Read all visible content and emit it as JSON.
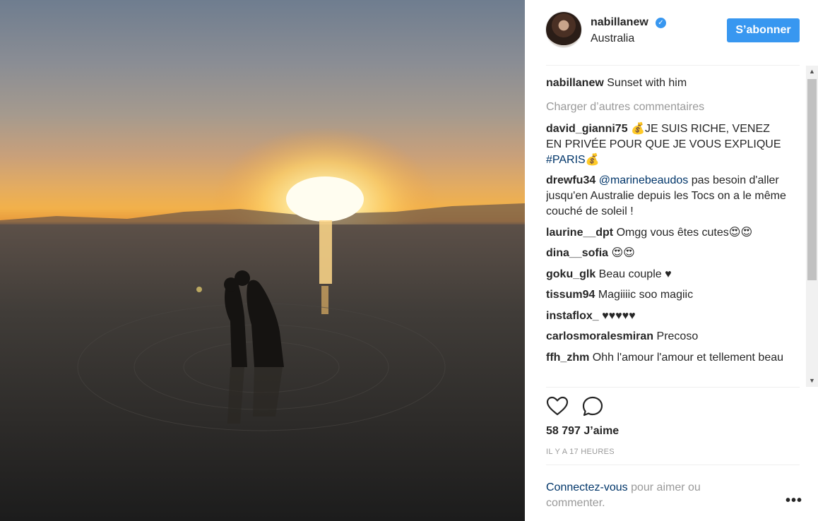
{
  "post": {
    "username": "nabillanew",
    "location": "Australia",
    "follow_label": "S’abonner",
    "verified_icon": "✓"
  },
  "comments": {
    "caption": {
      "user": "nabillanew",
      "text": "Sunset with him"
    },
    "load_more": "Charger d’autres commentaires",
    "items": [
      {
        "user": "david_gianni75",
        "text": " 💰JE SUIS RICHE, VENEZ EN PRIVÉE POUR QUE JE VOUS EXPLIQUE ",
        "tag": "#PARIS💰"
      },
      {
        "user": "drewfu34",
        "mention": "@marinebeaudos",
        "text": " pas besoin d'aller jusqu'en Australie depuis les Tocs on a le même couché de soleil !"
      },
      {
        "user": "laurine__dpt",
        "text": " Omgg vous êtes cutes😍😍"
      },
      {
        "user": "dina__sofia",
        "text": " 😍😍"
      },
      {
        "user": "goku_glk",
        "text": " Beau couple ♥"
      },
      {
        "user": "tissum94",
        "text": " Magiiiic soo magiic"
      },
      {
        "user": "instaflox_",
        "text": " ♥♥♥♥♥"
      },
      {
        "user": "carlosmoralesmiran",
        "text": " Precoso"
      },
      {
        "user": "ffh_zhm",
        "text": " Ohh l'amour l'amour et tellement beau"
      }
    ]
  },
  "stats": {
    "likes": "58 797 J’aime",
    "time_ago": "IL Y A 17 HEURES"
  },
  "login": {
    "link": "Connectez-vous",
    "text": " pour aimer ou commenter."
  },
  "more_label": "•••",
  "icons": {
    "like": "heart-icon",
    "comment": "comment-icon"
  },
  "colors": {
    "accent": "#3897f0",
    "link": "#003569",
    "muted": "#999999"
  }
}
